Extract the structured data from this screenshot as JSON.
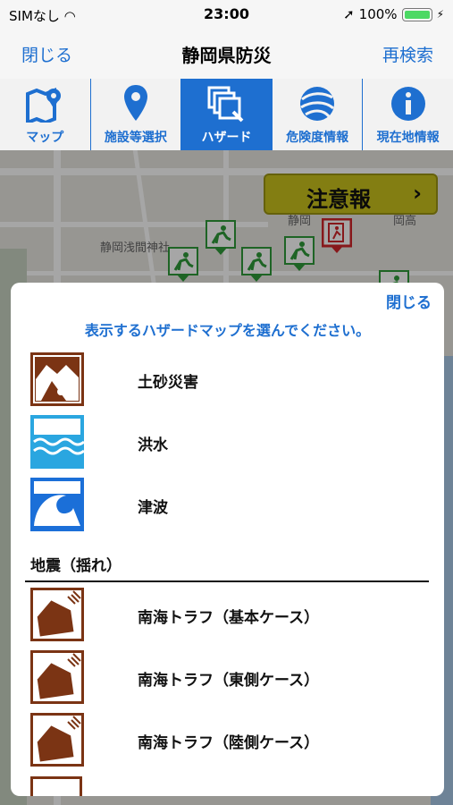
{
  "status_bar": {
    "carrier": "SIMなし",
    "time": "23:00",
    "battery": "100%"
  },
  "nav": {
    "left_button": "閉じる",
    "title": "静岡県防災",
    "right_button": "再検索"
  },
  "tabs": [
    {
      "label": "マップ",
      "icon": "map-icon",
      "active": false
    },
    {
      "label": "施設等選択",
      "icon": "location-pin-icon",
      "active": false
    },
    {
      "label": "ハザード",
      "icon": "hazard-layers-icon",
      "active": true
    },
    {
      "label": "危険度情報",
      "icon": "globe-icon",
      "active": false
    },
    {
      "label": "現在地情報",
      "icon": "info-icon",
      "active": false
    }
  ],
  "map": {
    "place_label": "静岡浅間神社",
    "place_label_2": "静岡",
    "place_label_3": "岡高"
  },
  "alert_banner": {
    "label": "注意報",
    "arrow": "›"
  },
  "sheet": {
    "close": "閉じる",
    "prompt": "表示するハザードマップを選んでください。",
    "items": [
      {
        "label": "土砂災害",
        "icon": "landslide-icon"
      },
      {
        "label": "洪水",
        "icon": "flood-icon"
      },
      {
        "label": "津波",
        "icon": "tsunami-icon"
      }
    ],
    "section_title": "地震（揺れ）",
    "quake_items": [
      {
        "label": "南海トラフ（基本ケース）",
        "icon": "earthquake-house-icon"
      },
      {
        "label": "南海トラフ（東側ケース）",
        "icon": "earthquake-house-icon"
      },
      {
        "label": "南海トラフ（陸側ケース）",
        "icon": "earthquake-house-icon"
      }
    ]
  },
  "colors": {
    "accent": "#1e6fd0",
    "alert": "#c9c21d",
    "landslide": "#7b3414",
    "flood": "#2aa6e0",
    "tsunami": "#1b6fd8",
    "shelter_green": "#2f9a3a",
    "shelter_red": "#d0262a"
  }
}
